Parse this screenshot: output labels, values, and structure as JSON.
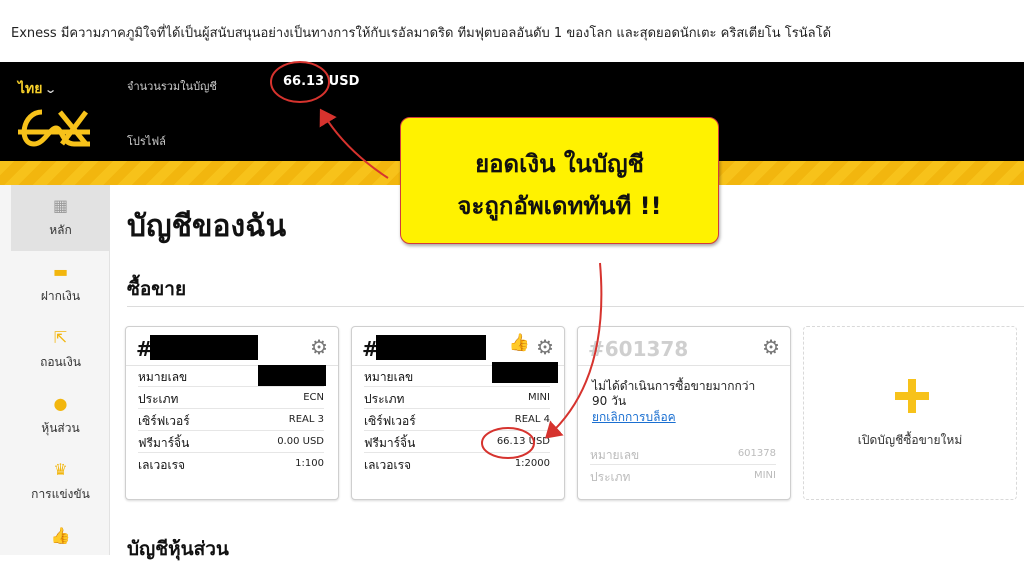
{
  "banner": {
    "text": "Exness มีความภาคภูมิใจที่ได้เป็นผู้สนับสนุนอย่างเป็นทางการให้กับเรอัลมาดริด ทีมฟุตบอลอันดับ 1 ของโลก และสุดยอดนักเตะ คริสเตียโน โรนัลโด้"
  },
  "topbar": {
    "language": "ไทย",
    "total_label": "จำนวนรวมในบัญชี",
    "total_value": "66.13 USD",
    "profile_label": "โปรไฟล์"
  },
  "sidebar": {
    "items": [
      {
        "label": "หลัก",
        "icon": "dashboard-icon"
      },
      {
        "label": "ฝากเงิน",
        "icon": "card-icon"
      },
      {
        "label": "ถอนเงิน",
        "icon": "withdraw-icon"
      },
      {
        "label": "หุ้นส่วน",
        "icon": "person-icon"
      },
      {
        "label": "การแข่งขัน",
        "icon": "trophy-icon"
      },
      {
        "label": "",
        "icon": "thumbs-up-icon"
      }
    ]
  },
  "main": {
    "title": "บัญชีของฉัน",
    "trading_section": "ซื้อขาย",
    "partner_section": "บัญชีหุ้นส่วน"
  },
  "cards": [
    {
      "number_prefix": "#",
      "rows": [
        {
          "label": "หมายเลข",
          "value": ""
        },
        {
          "label": "ประเภท",
          "value": "ECN"
        },
        {
          "label": "เซิร์ฟเวอร์",
          "value": "REAL 3"
        },
        {
          "label": "ฟรีมาร์จิ้น",
          "value": "0.00 USD"
        },
        {
          "label": "เลเวอเรจ",
          "value": "1:100"
        }
      ]
    },
    {
      "number_prefix": "#",
      "rows": [
        {
          "label": "หมายเลข",
          "value": ""
        },
        {
          "label": "ประเภท",
          "value": "MINI"
        },
        {
          "label": "เซิร์ฟเวอร์",
          "value": "REAL 4"
        },
        {
          "label": "ฟรีมาร์จิ้น",
          "value": "66.13 USD"
        },
        {
          "label": "เลเวอเรจ",
          "value": "1:2000"
        }
      ]
    },
    {
      "number_prefix": "#601378",
      "message": "ไม่ได้ดำเนินการซื้อขายมากกว่า 90 วัน",
      "link": "ยกเลิกการบล็อค",
      "rows": [
        {
          "label": "หมายเลข",
          "value": "601378"
        },
        {
          "label": "ประเภท",
          "value": "MINI"
        }
      ]
    }
  ],
  "new_account": {
    "label": "เปิดบัญชีซื้อขายใหม่"
  },
  "callout": {
    "line1": "ยอดเงิน ในบัญชี",
    "line2": "จะถูกอัพเดททันที !!"
  },
  "colors": {
    "accent": "#f7c21a",
    "annotation": "#d6332e",
    "callout_bg": "#fff200"
  }
}
